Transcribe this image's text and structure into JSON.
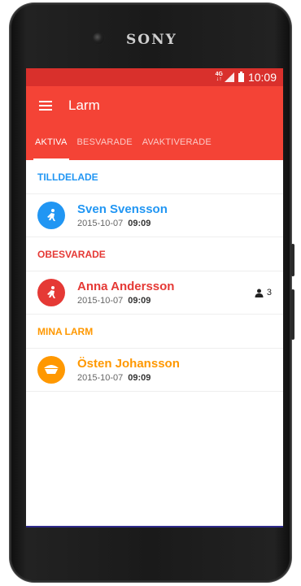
{
  "device": {
    "brand": "SONY"
  },
  "status_bar": {
    "network": [
      "4G",
      "↓↑"
    ],
    "time": "10:09"
  },
  "toolbar": {
    "title": "Larm",
    "menu_icon": "menu-icon"
  },
  "tabs": [
    {
      "label": "AKTIVA",
      "active": true
    },
    {
      "label": "BESVARADE",
      "active": false
    },
    {
      "label": "AVAKTIVERADE",
      "active": false
    }
  ],
  "colors": {
    "primary": "#f44336",
    "status_bar": "#d9302c",
    "blue": "#2196f3",
    "red": "#e53935",
    "orange": "#ff9800"
  },
  "sections": [
    {
      "title": "TILLDELADE",
      "color": "#2196f3",
      "items": [
        {
          "name": "Sven Svensson",
          "date": "2015-10-07",
          "time": "09:09",
          "icon": "fall-alarm-icon"
        }
      ]
    },
    {
      "title": "OBESVARADE",
      "color": "#e53935",
      "items": [
        {
          "name": "Anna Andersson",
          "date": "2015-10-07",
          "time": "09:09",
          "icon": "fall-alarm-icon",
          "responders": "3",
          "responder_icon": "person-icon"
        }
      ]
    },
    {
      "title": "MINA LARM",
      "color": "#ff9800",
      "items": [
        {
          "name": "Östen Johansson",
          "date": "2015-10-07",
          "time": "09:09",
          "icon": "bed-alarm-icon"
        }
      ]
    }
  ]
}
